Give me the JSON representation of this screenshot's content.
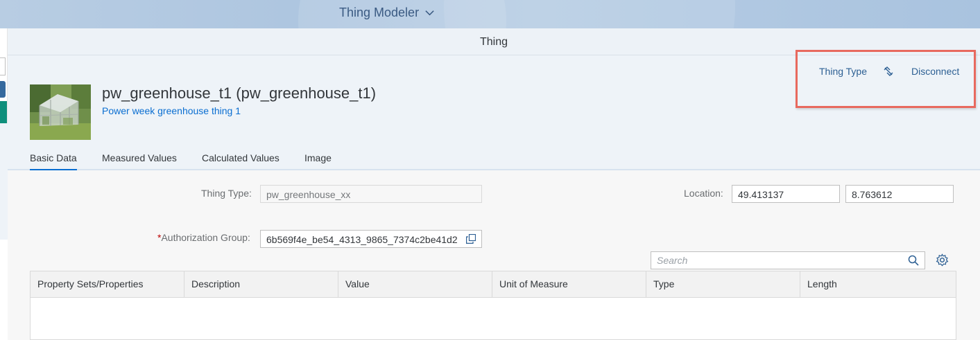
{
  "shell": {
    "app_title": "Thing Modeler"
  },
  "subheader": {
    "title": "Thing"
  },
  "object": {
    "title": "pw_greenhouse_t1 (pw_greenhouse_t1)",
    "subtitle": "Power week greenhouse thing 1"
  },
  "actions": {
    "thing_type": "Thing Type",
    "disconnect": "Disconnect"
  },
  "tabs": [
    {
      "label": "Basic Data",
      "active": true
    },
    {
      "label": "Measured Values"
    },
    {
      "label": "Calculated Values"
    },
    {
      "label": "Image"
    }
  ],
  "form": {
    "thing_type_label": "Thing Type:",
    "thing_type_value": "pw_greenhouse_xx",
    "location_label": "Location:",
    "latitude": "49.413137",
    "longitude": "8.763612",
    "required_marker": "*",
    "auth_group_label": "Authorization Group:",
    "auth_group_value": "6b569f4e_be54_4313_9865_7374c2be41d2"
  },
  "search": {
    "placeholder": "Search"
  },
  "table": {
    "columns": [
      "Property Sets/Properties",
      "Description",
      "Value",
      "Unit of Measure",
      "Type",
      "Length"
    ],
    "rows": []
  },
  "colors": {
    "accent": "#0a6ed1",
    "highlight_box": "#e8695e",
    "required": "#bb0000"
  },
  "icons": [
    "chevron-down-icon",
    "disconnect-icon",
    "copy-icon",
    "search-icon",
    "gear-icon"
  ]
}
